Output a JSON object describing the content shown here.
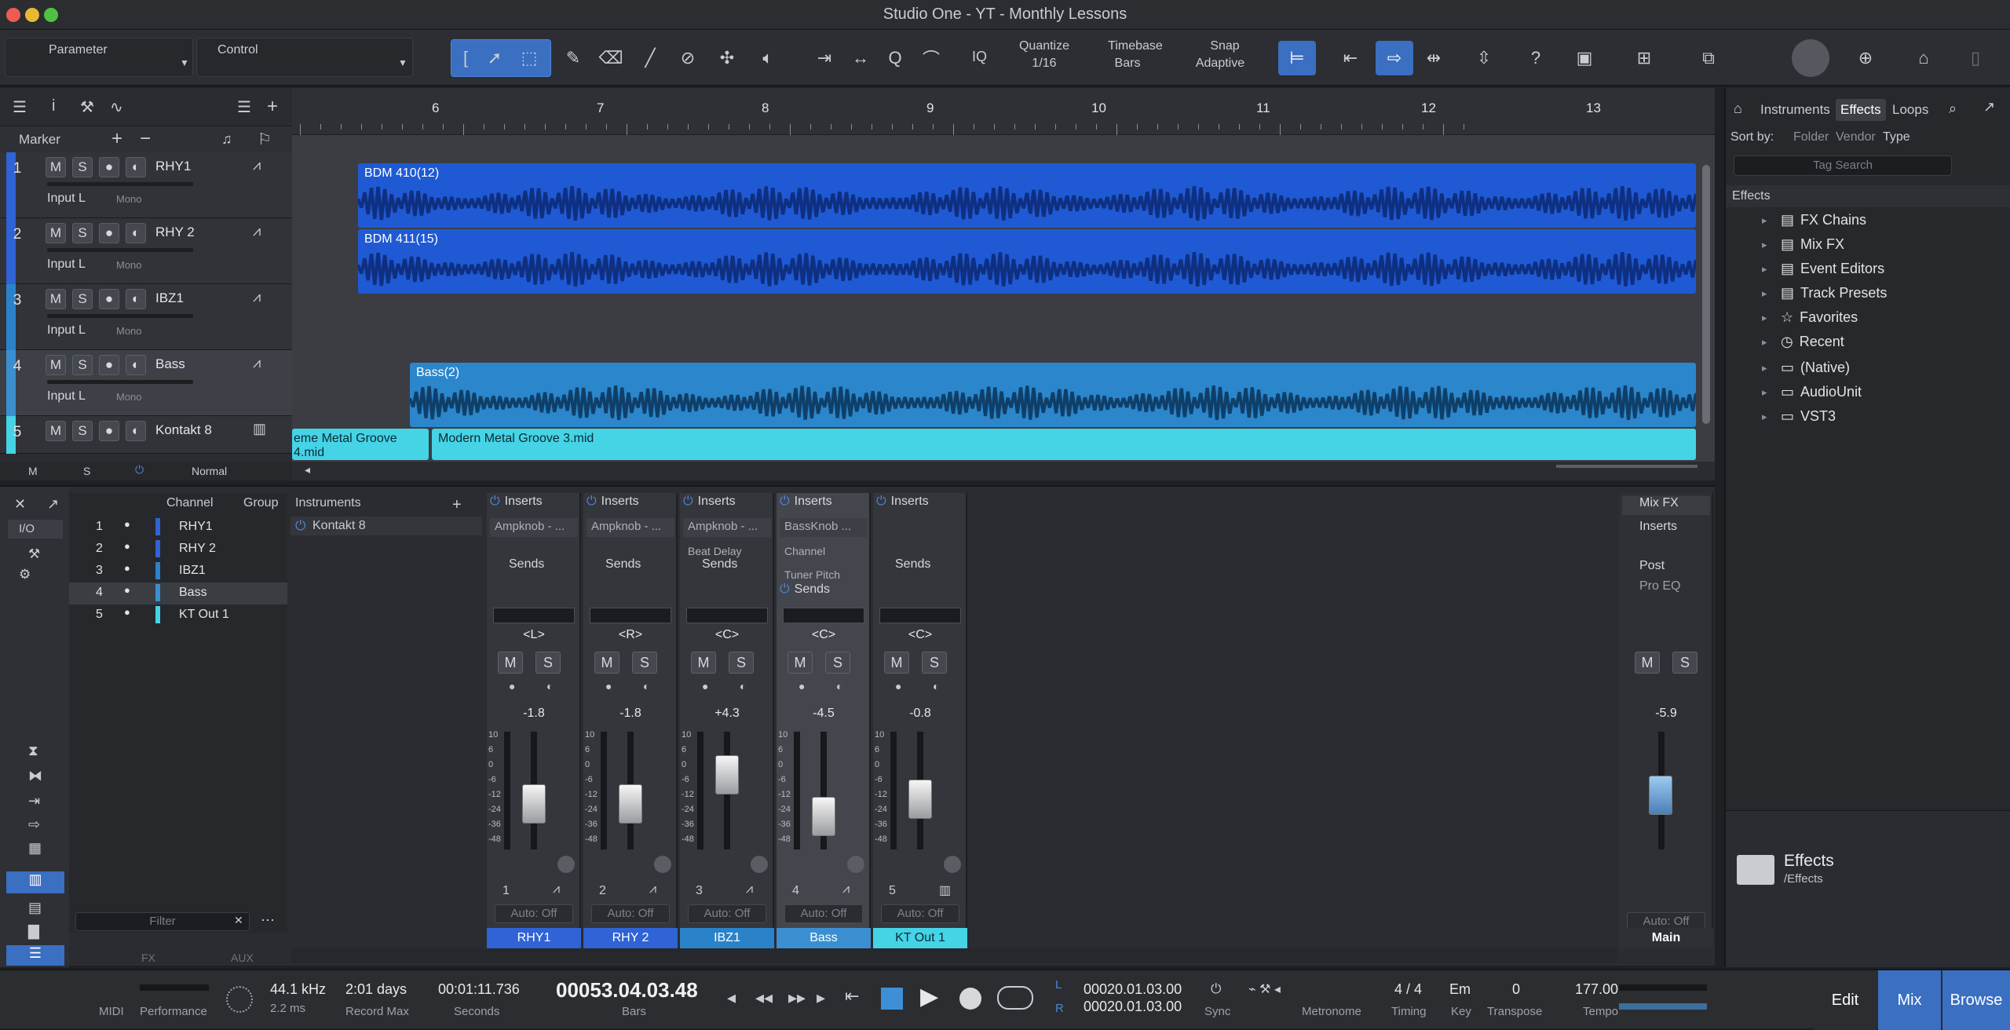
{
  "window": {
    "title": "Studio One - YT - Monthly Lessons"
  },
  "toolbar": {
    "parameter": "Parameter",
    "control": "Control",
    "quantize_label": "Quantize",
    "quantize_value": "1/16",
    "timebase_label": "Timebase",
    "timebase_value": "Bars",
    "snap_label": "Snap",
    "snap_value": "Adaptive",
    "iq": "IQ"
  },
  "track_panel": {
    "marker": "Marker",
    "footer_m": "M",
    "footer_s": "S",
    "footer_mode": "Normal"
  },
  "tracks": [
    {
      "num": "1",
      "name": "RHY1",
      "input": "Input L",
      "mono": "Mono",
      "color": "#2f63d6"
    },
    {
      "num": "2",
      "name": "RHY 2",
      "input": "Input L",
      "mono": "Mono",
      "color": "#2f63d6"
    },
    {
      "num": "3",
      "name": "IBZ1",
      "input": "Input L",
      "mono": "Mono",
      "color": "#2a83c9"
    },
    {
      "num": "4",
      "name": "Bass",
      "input": "Input L",
      "mono": "Mono",
      "color": "#3b8fd0"
    },
    {
      "num": "5",
      "name": "Kontakt 8",
      "color": "#45d3e6"
    }
  ],
  "ruler": [
    "6",
    "7",
    "8",
    "9",
    "10",
    "11",
    "12",
    "13"
  ],
  "clips": {
    "c1": "BDM 410(12)",
    "c2": "BDM 411(15)",
    "c4": "Bass(2)",
    "c5a": "eme Metal Groove 4.mid",
    "c5b": "Modern Metal Groove 3.mid"
  },
  "browser": {
    "tabs": [
      "Instruments",
      "Effects",
      "Loops"
    ],
    "sortby": "Sort by:",
    "sort_folder": "Folder",
    "sort_vendor": "Vendor",
    "sort_type": "Type",
    "tag_search": "Tag Search",
    "path": "Effects",
    "items": [
      "FX Chains",
      "Mix FX",
      "Event Editors",
      "Track Presets",
      "Favorites",
      "Recent",
      "(Native)",
      "AudioUnit",
      "VST3"
    ],
    "footer_title": "Effects",
    "footer_path": "/Effects"
  },
  "mixer": {
    "io": "I/O",
    "channel_hdr": "Channel",
    "group_hdr": "Group",
    "instruments_hdr": "Instruments",
    "instrument": "Kontakt 8",
    "filter": "Filter",
    "foot": [
      "FX",
      "AUX"
    ],
    "channels": [
      {
        "n": "1",
        "name": "RHY1"
      },
      {
        "n": "2",
        "name": "RHY 2"
      },
      {
        "n": "3",
        "name": "IBZ1"
      },
      {
        "n": "4",
        "name": "Bass"
      },
      {
        "n": "5",
        "name": "KT Out 1"
      }
    ],
    "strips": [
      {
        "insert": "Ampknob - ...",
        "pan": "<L>",
        "vol": "-1.8",
        "num": "1",
        "name": "RHY1",
        "color": "#2f63d6"
      },
      {
        "insert": "Ampknob - ...",
        "pan": "<R>",
        "vol": "-1.8",
        "num": "2",
        "name": "RHY 2",
        "color": "#2f63d6"
      },
      {
        "insert": "Ampknob - ...",
        "insert2": "Beat Delay",
        "pan": "<C>",
        "vol": "+4.3",
        "num": "3",
        "name": "IBZ1",
        "color": "#2a83c9"
      },
      {
        "insert": "BassKnob ...",
        "insert2": "Channel",
        "insert3": "Tuner Pitch",
        "pan": "<C>",
        "vol": "-4.5",
        "num": "4",
        "name": "Bass",
        "color": "#3b8fd0"
      },
      {
        "insert": "",
        "pan": "<C>",
        "vol": "-0.8",
        "num": "5",
        "name": "KT Out 1",
        "color": "#45d3e6"
      }
    ],
    "inserts": "Inserts",
    "sends": "Sends",
    "auto": "Auto: Off",
    "m": "M",
    "s": "S",
    "main": {
      "mixfx": "Mix FX",
      "inserts": "Inserts",
      "post": "Post",
      "proeq": "Pro EQ",
      "vol": "-5.9",
      "name": "Main"
    },
    "scale": [
      "10",
      "6",
      "0",
      "-6",
      "-12",
      "-24",
      "-36",
      "-48"
    ]
  },
  "transport": {
    "midi": "MIDI",
    "performance": "Performance",
    "rate": "44.1 kHz",
    "latency": "2.2 ms",
    "recmax_val": "2:01 days",
    "recmax": "Record Max",
    "seconds_val": "00:01:11.736",
    "seconds": "Seconds",
    "bars_val": "00053.04.03.48",
    "bars": "Bars",
    "l_val": "00020.01.03.00",
    "r_val": "00020.01.03.00",
    "sync": "Sync",
    "metronome": "Metronome",
    "timing_val": "4 / 4",
    "timing": "Timing",
    "key_val": "Em",
    "key": "Key",
    "transpose_val": "0",
    "transpose": "Transpose",
    "tempo_val": "177.00",
    "tempo": "Tempo",
    "edit": "Edit",
    "mix": "Mix",
    "browse": "Browse"
  }
}
